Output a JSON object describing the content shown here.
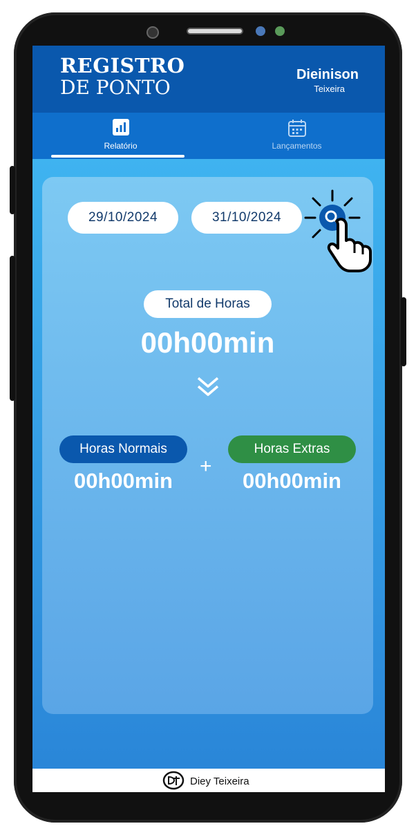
{
  "header": {
    "title_line1": "REGISTRO",
    "title_line2": "DE PONTO",
    "user_first": "Dieinison",
    "user_last": "Teixeira"
  },
  "tabs": [
    {
      "label": "Relatório",
      "icon": "bar-chart-icon",
      "active": true
    },
    {
      "label": "Lançamentos",
      "icon": "calendar-icon",
      "active": false
    }
  ],
  "filter": {
    "start_date": "29/10/2024",
    "end_date": "31/10/2024",
    "search_icon": "search-icon"
  },
  "summary": {
    "total_label": "Total de Horas",
    "total_value": "00h00min",
    "normal_label": "Horas Normais",
    "normal_value": "00h00min",
    "extra_label": "Horas Extras",
    "extra_value": "00h00min",
    "plus": "+"
  },
  "footer": {
    "credit": "Diey Teixeira"
  },
  "colors": {
    "primary": "#0a58ad",
    "tab_bg": "#0f6fcc",
    "extra_green": "#2f8f45",
    "content_top": "#3fb3f0"
  }
}
